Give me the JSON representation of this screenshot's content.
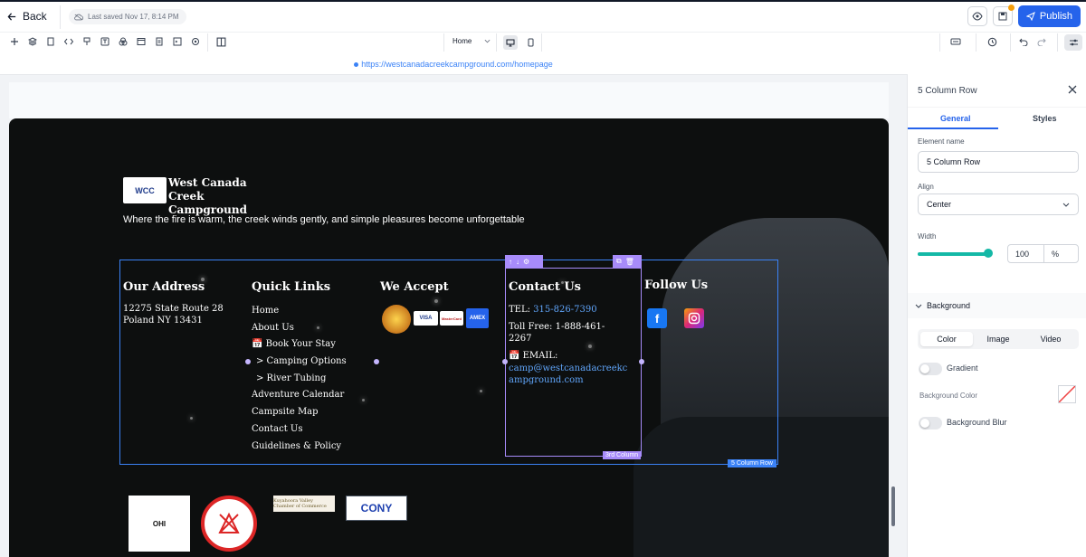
{
  "topbar": {
    "back_label": "Back",
    "last_saved": "Last saved Nov 17, 8:14 PM",
    "publish_label": "Publish"
  },
  "toolbar": {
    "page_select": "Home",
    "icons": [
      "plus-icon",
      "layers-icon",
      "pages-icon",
      "code-icon",
      "brush-icon",
      "text-icon",
      "shapes-icon",
      "browser-icon",
      "form-icon",
      "terminal-icon",
      "settings-icon",
      "columns-icon"
    ]
  },
  "url": "https://westcanadacreekcampground.com/homepage",
  "footer": {
    "logo_badge": "WCC",
    "logo_name": "West Canada Creek Campground",
    "tagline": "Where the fire is warm, the creek winds gently, and simple pleasures become unforgettable",
    "address": {
      "title": "Our Address",
      "line1": "12275 State Route 28",
      "line2": "Poland NY 13431"
    },
    "quick_links": {
      "title": "Quick Links",
      "items": [
        "Home",
        "About Us",
        "📅 Book Your Stay",
        "> Camping Options",
        "> River Tubing",
        "Adventure Calendar",
        "Campsite Map",
        "Contact Us",
        "Guidelines & Policy"
      ]
    },
    "accept": {
      "title": "We Accept",
      "cards": [
        "VISA",
        "MasterCard",
        "AMEX"
      ]
    },
    "contact": {
      "title": "Contact Us",
      "tel_prefix": "TEL: ",
      "tel": "315-826-7390",
      "tollfree_1": "Toll Free: 1-888-461-",
      "tollfree_2": "2267",
      "email_label": "📅 EMAIL:",
      "email_1": "camp@westcanadacreekc",
      "email_2": "ampground.com"
    },
    "follow": {
      "title": "Follow Us"
    },
    "partners": [
      "OHI",
      "Kuyahoora Valley Chamber of Commerce",
      "CONY"
    ],
    "row_label": "5 Column Row",
    "col_label": "3rd Column"
  },
  "panel": {
    "title": "5 Column Row",
    "tabs": [
      "General",
      "Styles"
    ],
    "element_name_label": "Element name",
    "element_name_value": "5 Column Row",
    "align_label": "Align",
    "align_value": "Center",
    "width_label": "Width",
    "width_value": "100",
    "width_unit": "%",
    "width_fraction": 1.0,
    "background_label": "Background",
    "bg_tabs": [
      "Color",
      "Image",
      "Video"
    ],
    "gradient_label": "Gradient",
    "bg_color_label": "Background Color",
    "bg_blur_label": "Background Blur"
  },
  "colors": {
    "accent": "#2563eb",
    "teal": "#14b8a6",
    "selection_blue": "#3b82f6",
    "selection_purple": "#a78bfa"
  }
}
